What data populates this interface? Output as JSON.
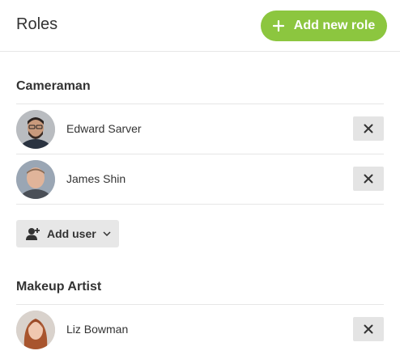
{
  "header": {
    "title": "Roles",
    "add_role_label": "Add new role"
  },
  "colors": {
    "accent": "#8cc63f",
    "button_gray": "#e4e4e4",
    "divider": "#e6e6e6"
  },
  "roles": [
    {
      "name": "Cameraman",
      "users": [
        {
          "name": "Edward Sarver"
        },
        {
          "name": "James Shin"
        }
      ],
      "add_user_label": "Add user"
    },
    {
      "name": "Makeup Artist",
      "users": [
        {
          "name": "Liz Bowman"
        }
      ]
    }
  ],
  "icons": {
    "add_role": "plus-icon",
    "remove": "close-icon",
    "add_user": "add-user-icon",
    "dropdown": "chevron-down-icon"
  }
}
